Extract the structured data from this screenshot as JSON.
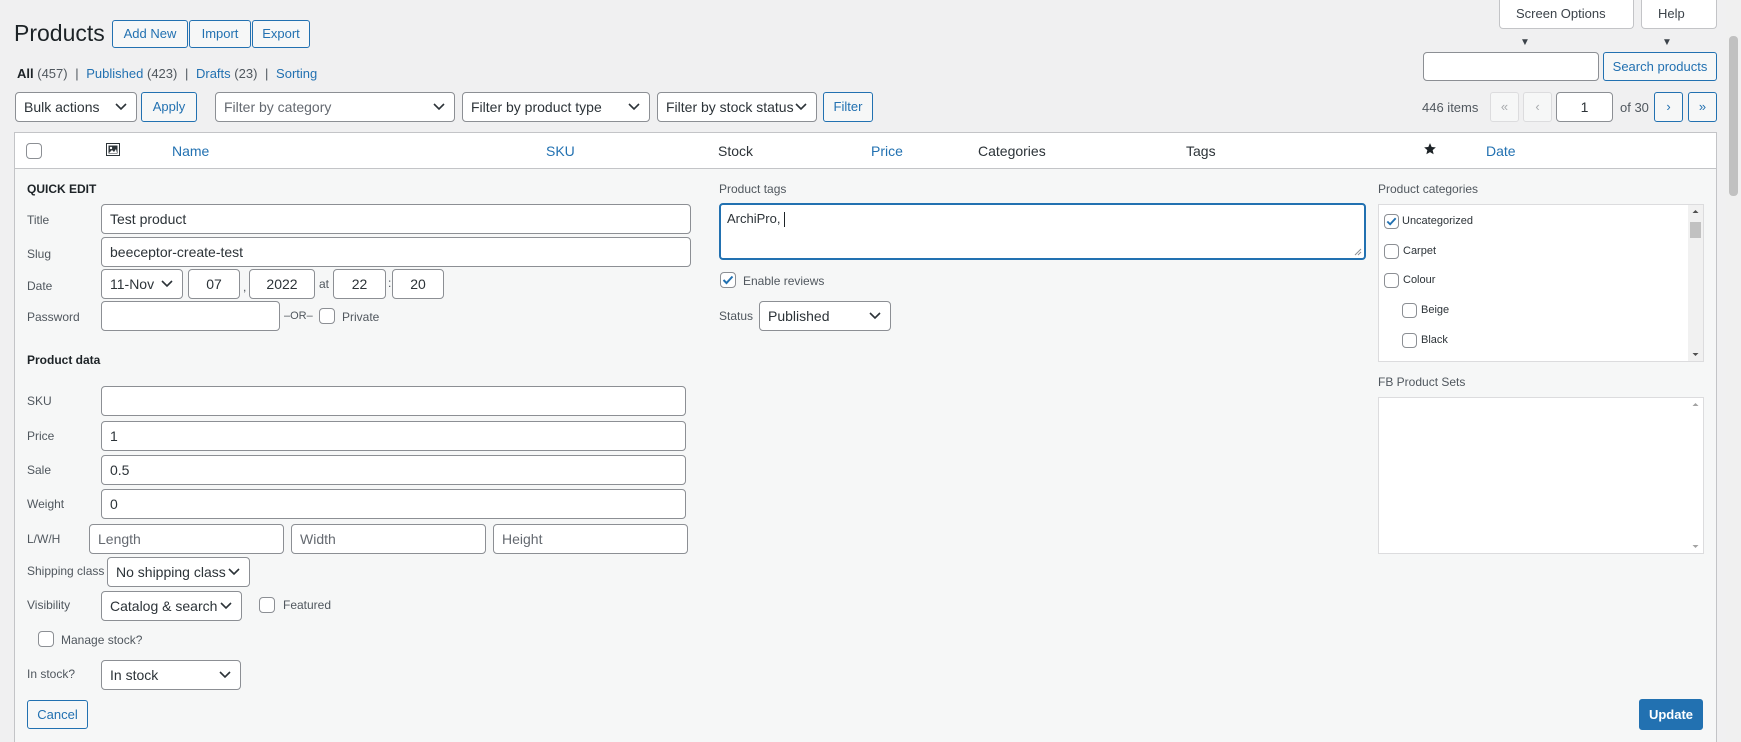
{
  "page": {
    "title": "Products",
    "buttons": {
      "add_new": "Add New",
      "import": "Import",
      "export": "Export"
    },
    "screen_options": "Screen Options",
    "help": "Help"
  },
  "views": [
    {
      "label": "All",
      "count": "(457)"
    },
    {
      "label": "Published",
      "count": "(423)"
    },
    {
      "label": "Drafts",
      "count": "(23)"
    },
    {
      "label": "Sorting",
      "count": ""
    }
  ],
  "search": {
    "value": "",
    "button": "Search products"
  },
  "toolbar": {
    "bulk_actions": "Bulk actions",
    "apply": "Apply",
    "filter_category": "Filter by category",
    "filter_type": "Filter by product type",
    "filter_stock": "Filter by stock status",
    "filter": "Filter"
  },
  "pagination": {
    "items": "446 items",
    "first": "«",
    "prev": "‹",
    "current": "1",
    "of": "of 30",
    "next": "›",
    "last": "»"
  },
  "columns": {
    "name": "Name",
    "sku": "SKU",
    "stock": "Stock",
    "price": "Price",
    "categories": "Categories",
    "tags": "Tags",
    "date": "Date"
  },
  "quick_edit": {
    "heading": "QUICK EDIT",
    "title_label": "Title",
    "title_value": "Test product",
    "slug_label": "Slug",
    "slug_value": "beeceptor-create-test",
    "date_label": "Date",
    "month": "11-Nov",
    "day": "07",
    "year": "2022",
    "at": "at",
    "hour": "22",
    "minute": "20",
    "comma": ",",
    "colon": ":",
    "password_label": "Password",
    "password_value": "",
    "or": "–OR–",
    "private_label": "Private",
    "product_data": "Product data",
    "sku_label": "SKU",
    "sku_value": "",
    "price_label": "Price",
    "price_value": "1",
    "sale_label": "Sale",
    "sale_value": "0.5",
    "weight_label": "Weight",
    "weight_value": "0",
    "lwh_label": "L/W/H",
    "length_ph": "Length",
    "width_ph": "Width",
    "height_ph": "Height",
    "shipping_label": "Shipping class",
    "shipping_value": "No shipping class",
    "visibility_label": "Visibility",
    "visibility_value": "Catalog & search",
    "featured_label": "Featured",
    "manage_stock_label": "Manage stock?",
    "in_stock_label": "In stock?",
    "in_stock_value": "In stock",
    "tags_label": "Product tags",
    "tags_value": "ArchiPro, ",
    "enable_reviews_label": "Enable reviews",
    "status_label": "Status",
    "status_value": "Published",
    "categories_label": "Product categories",
    "categories": [
      {
        "label": "Uncategorized",
        "checked": true
      },
      {
        "label": "Carpet",
        "checked": false
      },
      {
        "label": "Colour",
        "checked": false
      },
      {
        "label": "Beige",
        "checked": false
      },
      {
        "label": "Black",
        "checked": false
      }
    ],
    "fb_sets_label": "FB Product Sets",
    "cancel": "Cancel",
    "update": "Update"
  },
  "colors": {
    "accent": "#2271b1",
    "background": "#f0f0f1",
    "text": "#1d2327"
  }
}
